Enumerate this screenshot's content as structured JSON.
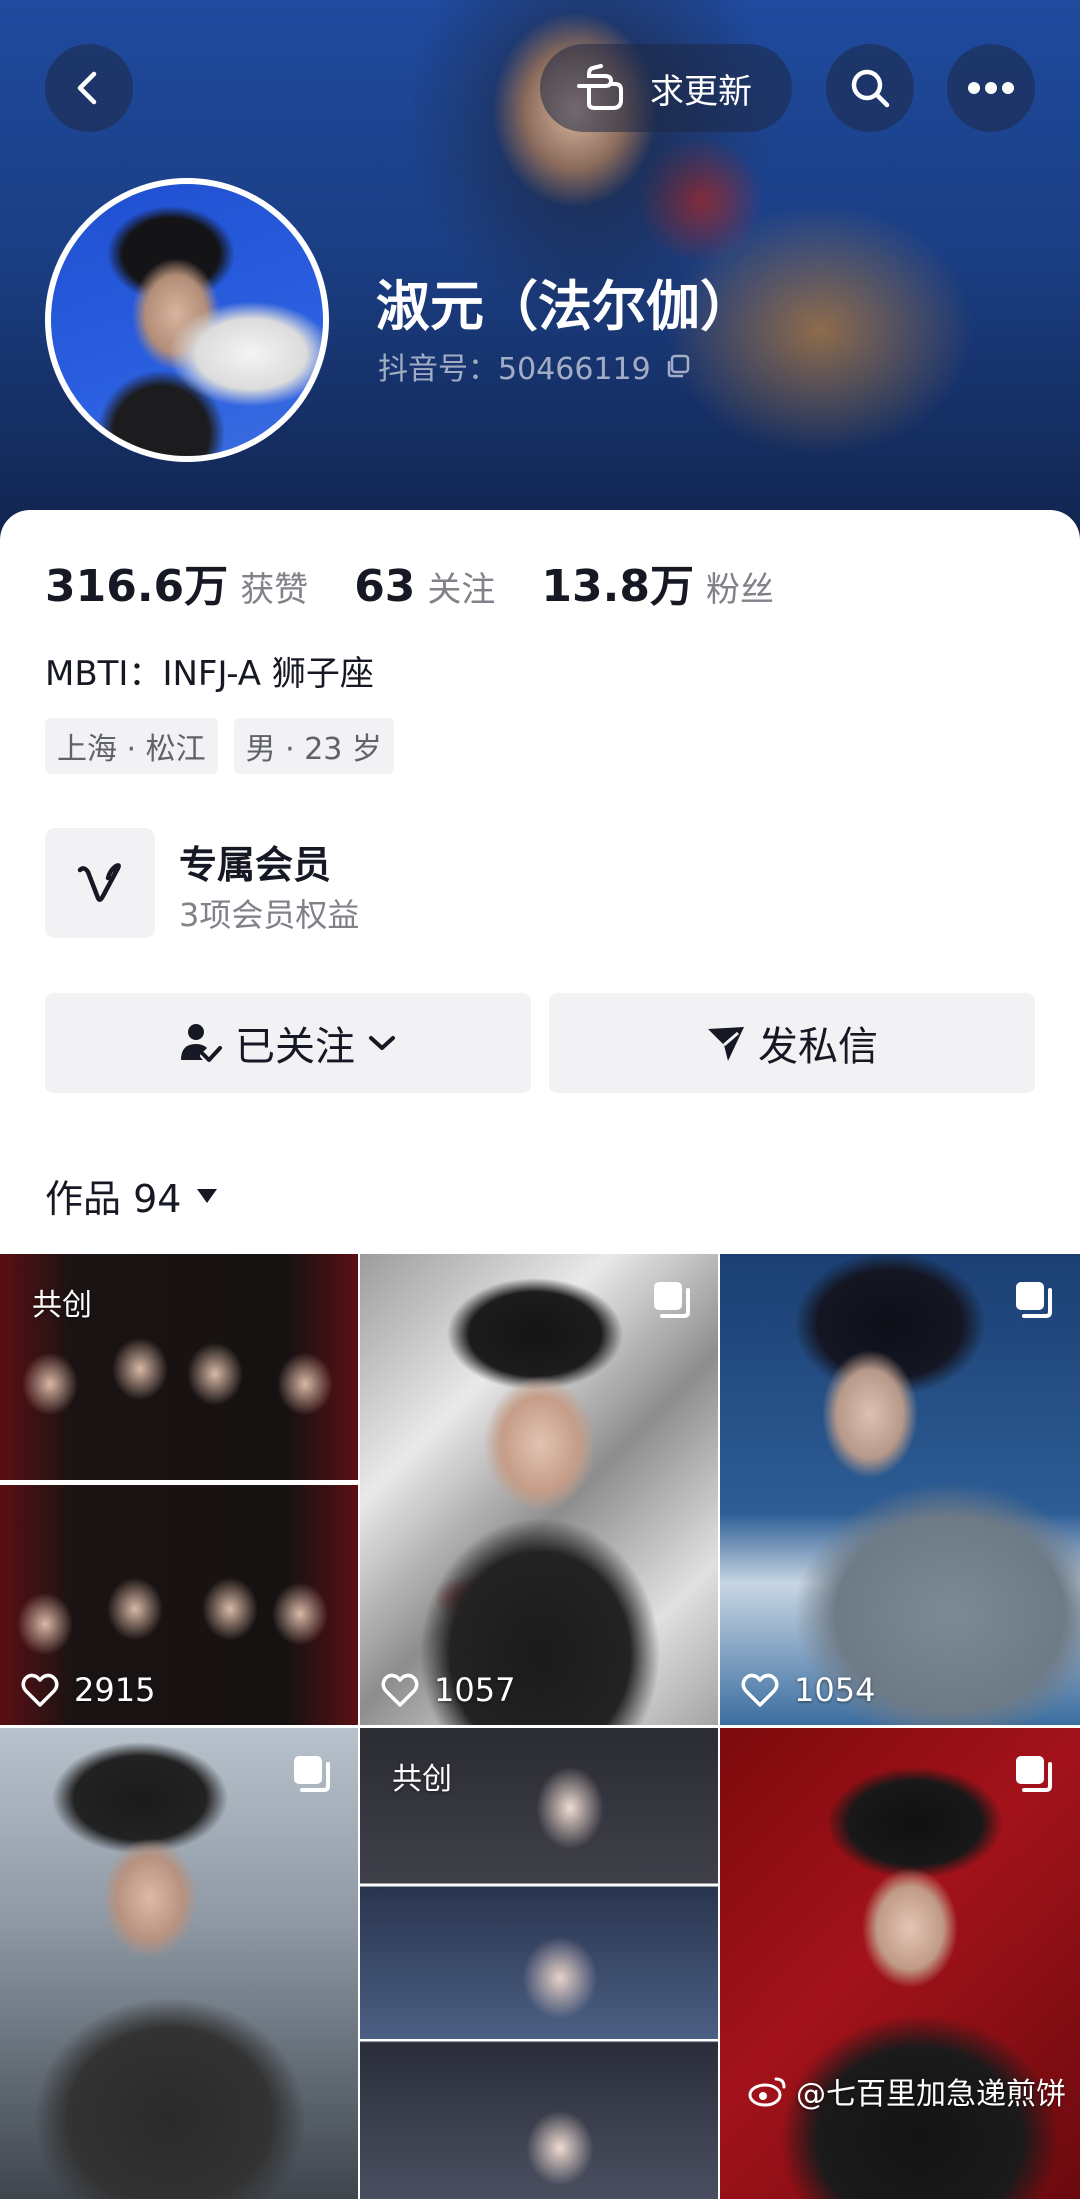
{
  "header": {
    "back_icon": "chevron-left-icon",
    "update_label": "求更新",
    "search_icon": "search-icon",
    "more_icon": "more-dots-icon"
  },
  "profile": {
    "name": "淑元（法尔伽）",
    "douyin_id": "抖音号：50466119",
    "stats": [
      {
        "value": "316.6万",
        "label": "获赞"
      },
      {
        "value": "63",
        "label": "关注"
      },
      {
        "value": "13.8万",
        "label": "粉丝"
      }
    ],
    "bio": "MBTI：INFJ-A  狮子座",
    "tags": [
      "上海 · 松江",
      "男 · 23 岁"
    ]
  },
  "membership": {
    "title": "专属会员",
    "subtitle": "3项会员权益"
  },
  "actions": {
    "following_label": "已关注",
    "message_label": "发私信"
  },
  "works": {
    "label": "作品 94",
    "items": [
      {
        "badge": "共创",
        "likes": "2915",
        "multi": false
      },
      {
        "badge": "",
        "likes": "1057",
        "multi": true
      },
      {
        "badge": "",
        "likes": "1054",
        "multi": true
      },
      {
        "badge": "",
        "likes": "",
        "multi": true
      },
      {
        "badge": "共创",
        "likes": "",
        "multi": false
      },
      {
        "badge": "",
        "likes": "",
        "multi": true
      }
    ]
  },
  "watermark": "@七百里加急递煎饼",
  "colors": {
    "text_primary": "#161823",
    "text_secondary": "#80828a",
    "button_bg": "#f2f2f4",
    "header_blue": "#1f4a9e"
  }
}
